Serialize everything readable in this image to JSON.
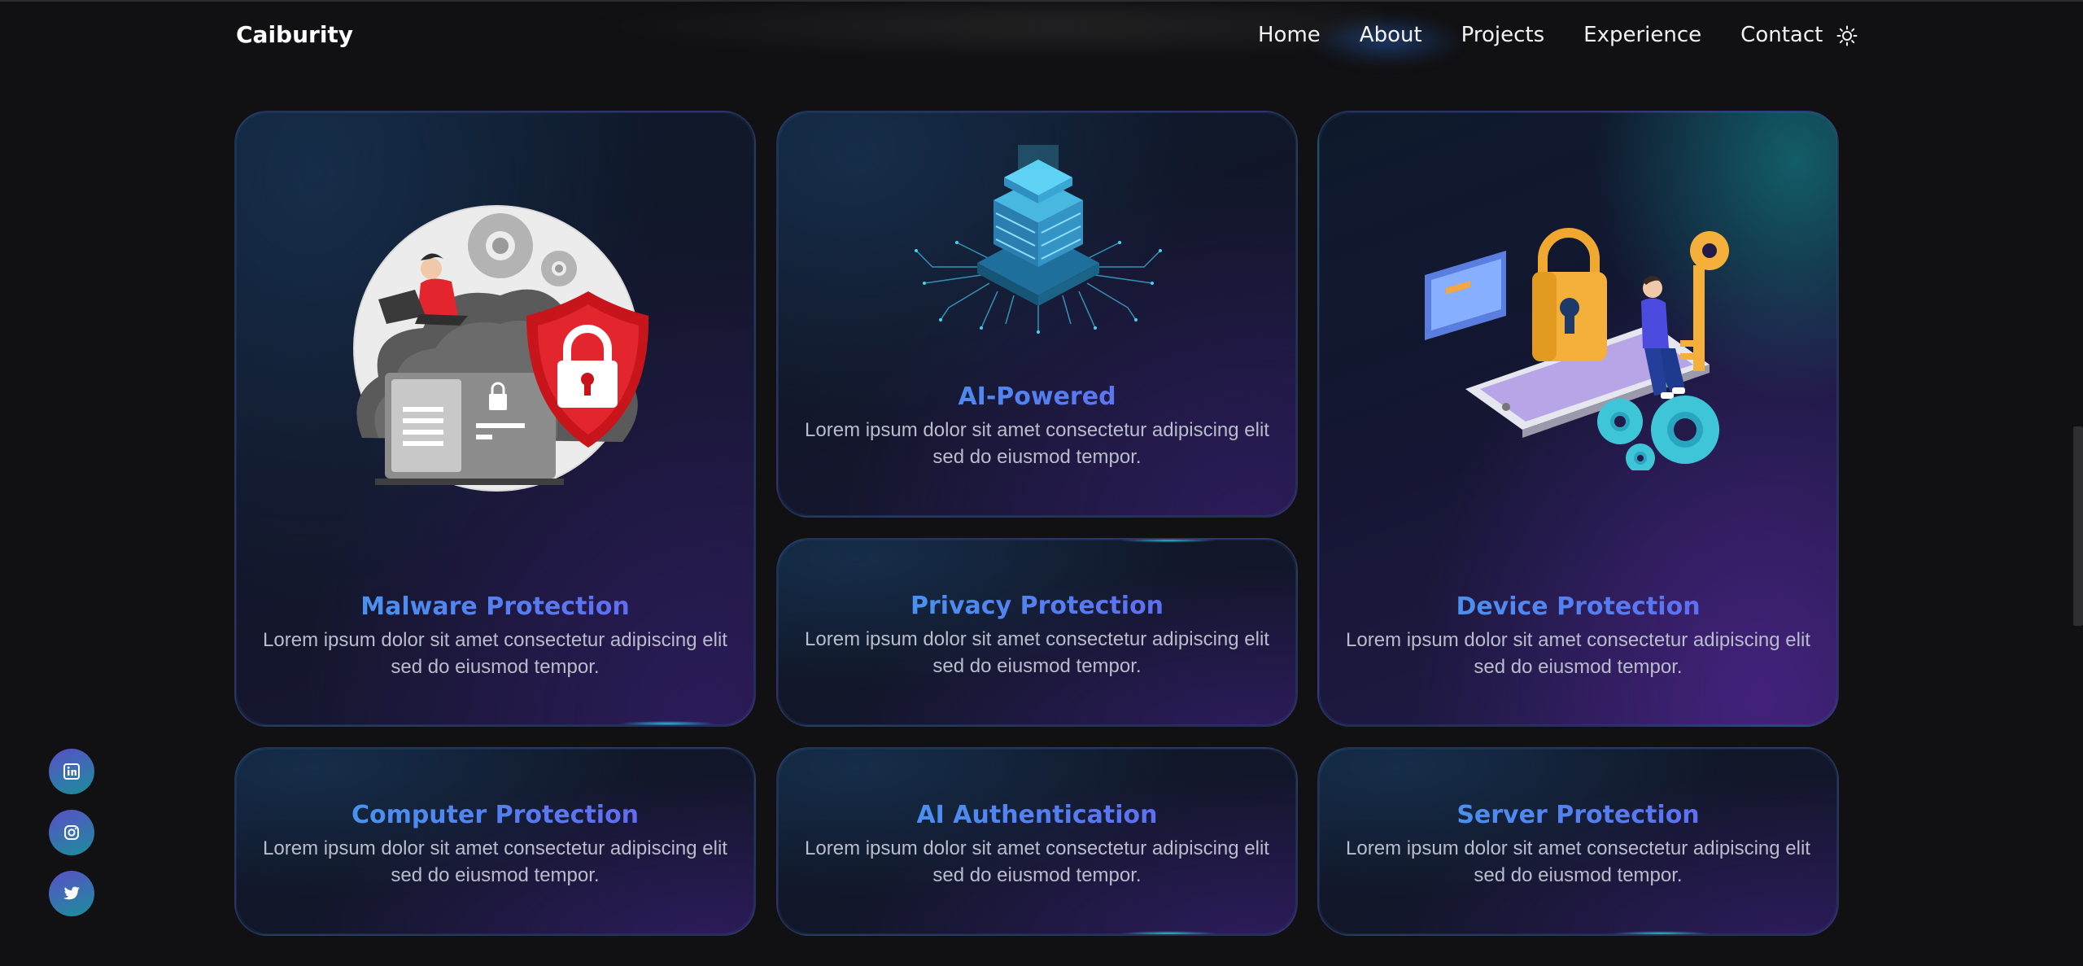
{
  "nav": {
    "brand": "Caiburity",
    "links": [
      "Home",
      "About",
      "Projects",
      "Experience",
      "Contact"
    ],
    "theme_icon": "sun-icon"
  },
  "cards": [
    {
      "id": "malware",
      "title": "Malware Protection",
      "desc": "Lorem ipsum dolor sit amet consectetur adipiscing elit sed do eiusmod tempor.",
      "illustration": "cloud-shield-lock-illustration"
    },
    {
      "id": "ai-powered",
      "title": "AI-Powered",
      "desc": "Lorem ipsum dolor sit amet consectetur adipiscing elit sed do eiusmod tempor.",
      "illustration": "ai-chip-illustration"
    },
    {
      "id": "device",
      "title": "Device Protection",
      "desc": "Lorem ipsum dolor sit amet consectetur adipiscing elit sed do eiusmod tempor.",
      "illustration": "phone-padlock-key-illustration"
    },
    {
      "id": "privacy",
      "title": "Privacy Protection",
      "desc": "Lorem ipsum dolor sit amet consectetur adipiscing elit sed do eiusmod tempor."
    },
    {
      "id": "computer",
      "title": "Computer Protection",
      "desc": "Lorem ipsum dolor sit amet consectetur adipiscing elit sed do eiusmod tempor."
    },
    {
      "id": "ai-auth",
      "title": "AI Authentication",
      "desc": "Lorem ipsum dolor sit amet consectetur adipiscing elit sed do eiusmod tempor."
    },
    {
      "id": "server",
      "title": "Server Protection",
      "desc": "Lorem ipsum dolor sit amet consectetur adipiscing elit sed do eiusmod tempor."
    }
  ],
  "social": [
    "linkedin-icon",
    "instagram-icon",
    "twitter-icon"
  ],
  "colors": {
    "accent_start": "#3fa3ee",
    "accent_end": "#6a5cf2",
    "background": "#111113"
  }
}
